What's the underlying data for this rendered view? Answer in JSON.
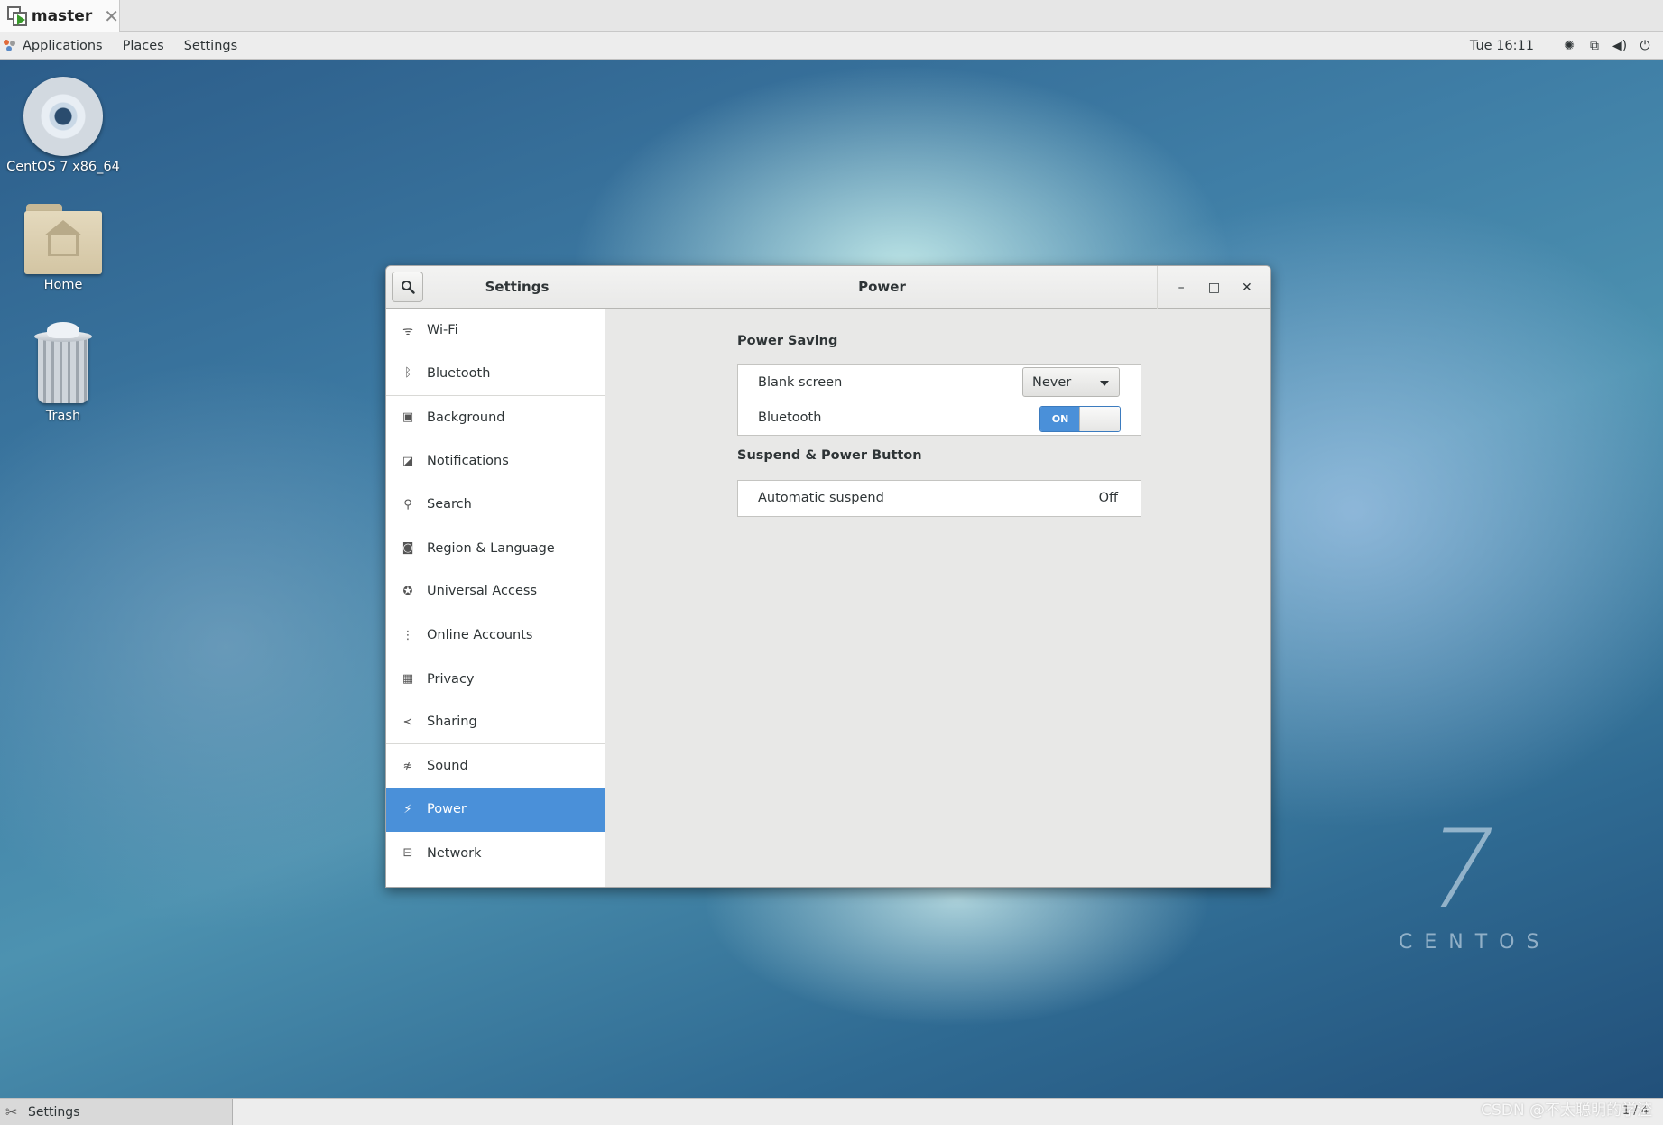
{
  "vm_tab": {
    "title": "master",
    "close_glyph": "✕"
  },
  "topbar": {
    "menus": [
      "Applications",
      "Places",
      "Settings"
    ],
    "clock": "Tue 16:11",
    "tray_icons": [
      "accessibility-icon",
      "network-wired-icon",
      "volume-icon",
      "power-icon"
    ]
  },
  "desktop": {
    "icons": [
      {
        "label": "CentOS 7 x86_64",
        "icon": "cd-drive-icon"
      },
      {
        "label": "Home",
        "icon": "home-folder-icon"
      },
      {
        "label": "Trash",
        "icon": "trash-icon"
      }
    ],
    "brand_numeral": "7",
    "brand_word": "CENTOS"
  },
  "window": {
    "sidebar_title": "Settings",
    "panel_title": "Power",
    "controls": {
      "minimize": "–",
      "maximize": "□",
      "close": "✕"
    }
  },
  "sidebar": {
    "items": [
      {
        "label": "Wi-Fi",
        "icon": "wifi-icon",
        "glyph": "ᯤ"
      },
      {
        "label": "Bluetooth",
        "icon": "bluetooth-icon",
        "glyph": "ᛒ"
      },
      {
        "label": "Background",
        "icon": "background-icon",
        "glyph": "▣"
      },
      {
        "label": "Notifications",
        "icon": "notifications-icon",
        "glyph": "◪"
      },
      {
        "label": "Search",
        "icon": "search-icon",
        "glyph": "⚲"
      },
      {
        "label": "Region & Language",
        "icon": "region-icon",
        "glyph": "◙"
      },
      {
        "label": "Universal Access",
        "icon": "universal-access-icon",
        "glyph": "✪"
      },
      {
        "label": "Online Accounts",
        "icon": "online-accounts-icon",
        "glyph": "⋮"
      },
      {
        "label": "Privacy",
        "icon": "privacy-icon",
        "glyph": "▦"
      },
      {
        "label": "Sharing",
        "icon": "sharing-icon",
        "glyph": "≺"
      },
      {
        "label": "Sound",
        "icon": "sound-icon",
        "glyph": "≉"
      },
      {
        "label": "Power",
        "icon": "power-icon",
        "glyph": "⚡"
      },
      {
        "label": "Network",
        "icon": "network-icon",
        "glyph": "⊟"
      }
    ],
    "active_index": 11
  },
  "power": {
    "power_saving_title": "Power Saving",
    "blank_screen_label": "Blank screen",
    "blank_screen_value": "Never",
    "bluetooth_label": "Bluetooth",
    "bluetooth_switch": "ON",
    "suspend_title": "Suspend & Power Button",
    "automatic_suspend_label": "Automatic suspend",
    "automatic_suspend_value": "Off"
  },
  "taskbar": {
    "window_label": "Settings",
    "workspace": "1 / 4"
  },
  "watermark": "CSDN @不太聪明的学渣"
}
